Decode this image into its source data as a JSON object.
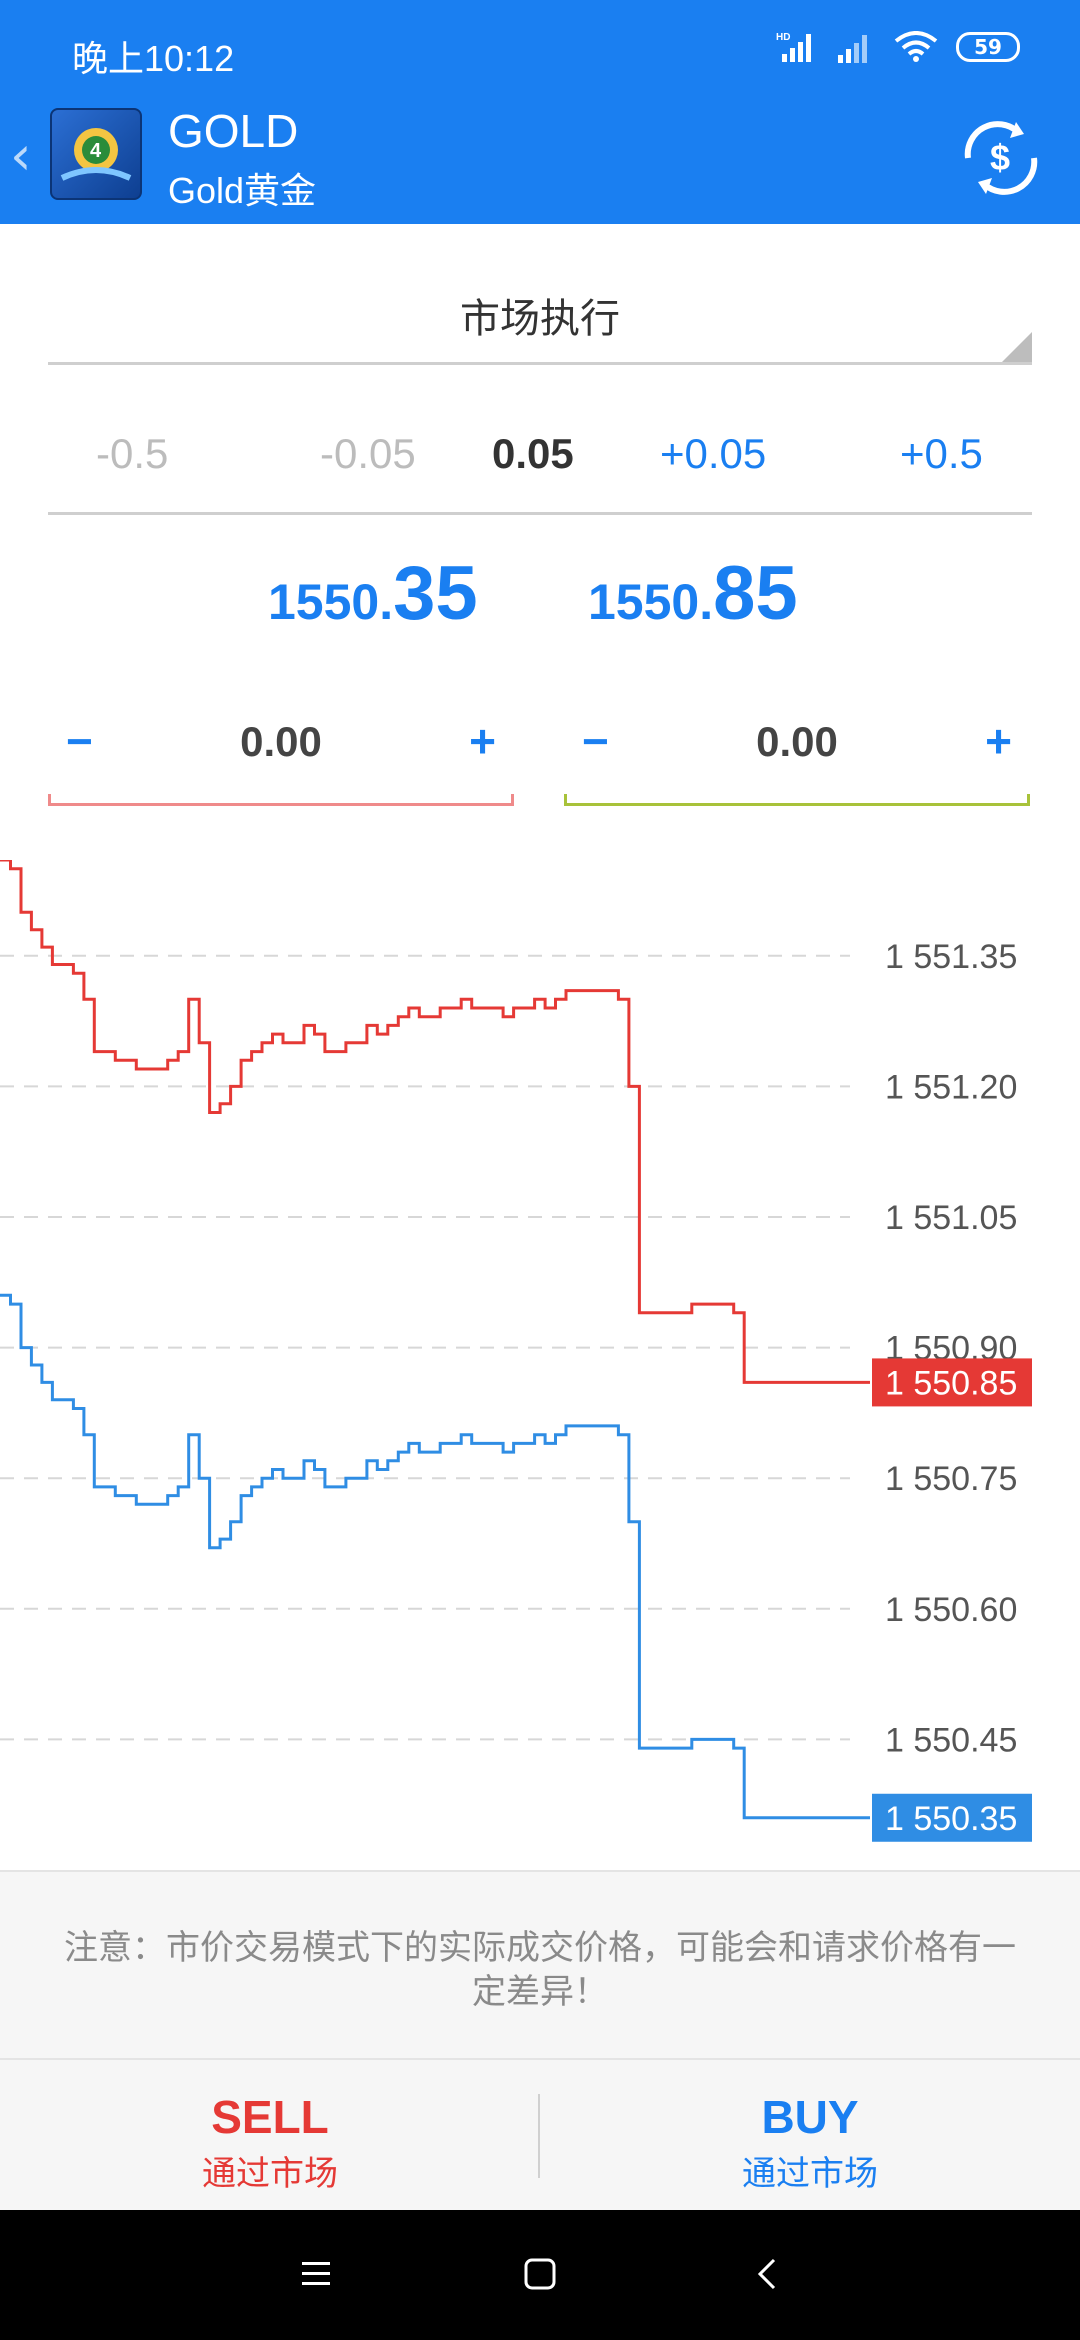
{
  "status_bar": {
    "time": "晚上10:12",
    "battery": "59",
    "signal_label": "HD"
  },
  "header": {
    "title": "GOLD",
    "subtitle": "Gold黄金"
  },
  "execution": {
    "type": "市场执行"
  },
  "volume": {
    "options": [
      "-0.5",
      "-0.05",
      "0.05",
      "+0.05",
      "+0.5"
    ],
    "current": "0.05"
  },
  "prices": {
    "sell": {
      "prefix": "1550.",
      "suffix": "35"
    },
    "buy": {
      "prefix": "1550.",
      "suffix": "85"
    }
  },
  "stop_loss": {
    "minus": "−",
    "value": "0.00",
    "plus": "+",
    "color": "#ef8a8a"
  },
  "take_profit": {
    "minus": "−",
    "value": "0.00",
    "plus": "+",
    "color": "#a8c23a"
  },
  "chart_data": {
    "type": "line",
    "y_ticks": [
      "1 551.35",
      "1 551.20",
      "1 551.05",
      "1 550.90",
      "1 550.75",
      "1 550.60",
      "1 550.45"
    ],
    "ylim": [
      1550.3,
      1551.46
    ],
    "grid": true,
    "series": [
      {
        "color": "#e53935",
        "label": "1 550.85",
        "values": [
          1551.46,
          1551.45,
          1551.4,
          1551.38,
          1551.36,
          1551.34,
          1551.34,
          1551.33,
          1551.3,
          1551.24,
          1551.24,
          1551.23,
          1551.23,
          1551.22,
          1551.22,
          1551.22,
          1551.23,
          1551.24,
          1551.3,
          1551.25,
          1551.17,
          1551.18,
          1551.2,
          1551.23,
          1551.24,
          1551.25,
          1551.26,
          1551.25,
          1551.25,
          1551.27,
          1551.26,
          1551.24,
          1551.24,
          1551.25,
          1551.25,
          1551.27,
          1551.26,
          1551.27,
          1551.28,
          1551.29,
          1551.28,
          1551.28,
          1551.29,
          1551.29,
          1551.3,
          1551.29,
          1551.29,
          1551.29,
          1551.28,
          1551.29,
          1551.29,
          1551.3,
          1551.29,
          1551.3,
          1551.31,
          1551.31,
          1551.31,
          1551.31,
          1551.31,
          1551.3,
          1551.2,
          1550.94,
          1550.94,
          1550.94,
          1550.94,
          1550.94,
          1550.95,
          1550.95,
          1550.95,
          1550.95,
          1550.94,
          1550.86,
          1550.86,
          1550.86,
          1550.86,
          1550.86,
          1550.86,
          1550.86,
          1550.86,
          1550.86,
          1550.86,
          1550.86,
          1550.86,
          1550.86
        ]
      },
      {
        "color": "#2f8de4",
        "label": "1 550.35",
        "values": [
          1550.96,
          1550.95,
          1550.9,
          1550.88,
          1550.86,
          1550.84,
          1550.84,
          1550.83,
          1550.8,
          1550.74,
          1550.74,
          1550.73,
          1550.73,
          1550.72,
          1550.72,
          1550.72,
          1550.73,
          1550.74,
          1550.8,
          1550.75,
          1550.67,
          1550.68,
          1550.7,
          1550.73,
          1550.74,
          1550.75,
          1550.76,
          1550.75,
          1550.75,
          1550.77,
          1550.76,
          1550.74,
          1550.74,
          1550.75,
          1550.75,
          1550.77,
          1550.76,
          1550.77,
          1550.78,
          1550.79,
          1550.78,
          1550.78,
          1550.79,
          1550.79,
          1550.8,
          1550.79,
          1550.79,
          1550.79,
          1550.78,
          1550.79,
          1550.79,
          1550.8,
          1550.79,
          1550.8,
          1550.81,
          1550.81,
          1550.81,
          1550.81,
          1550.81,
          1550.8,
          1550.7,
          1550.44,
          1550.44,
          1550.44,
          1550.44,
          1550.44,
          1550.45,
          1550.45,
          1550.45,
          1550.45,
          1550.44,
          1550.36,
          1550.36,
          1550.36,
          1550.36,
          1550.36,
          1550.36,
          1550.36,
          1550.36,
          1550.36,
          1550.36,
          1550.36,
          1550.36,
          1550.36
        ]
      }
    ]
  },
  "notice": {
    "text": "注意：市价交易模式下的实际成交价格，可能会和请求价格有一定差异！"
  },
  "actions": {
    "sell": {
      "label": "SELL",
      "sub": "通过市场",
      "color": "#e53935"
    },
    "buy": {
      "label": "BUY",
      "sub": "通过市场",
      "color": "#1a7ff1"
    }
  }
}
